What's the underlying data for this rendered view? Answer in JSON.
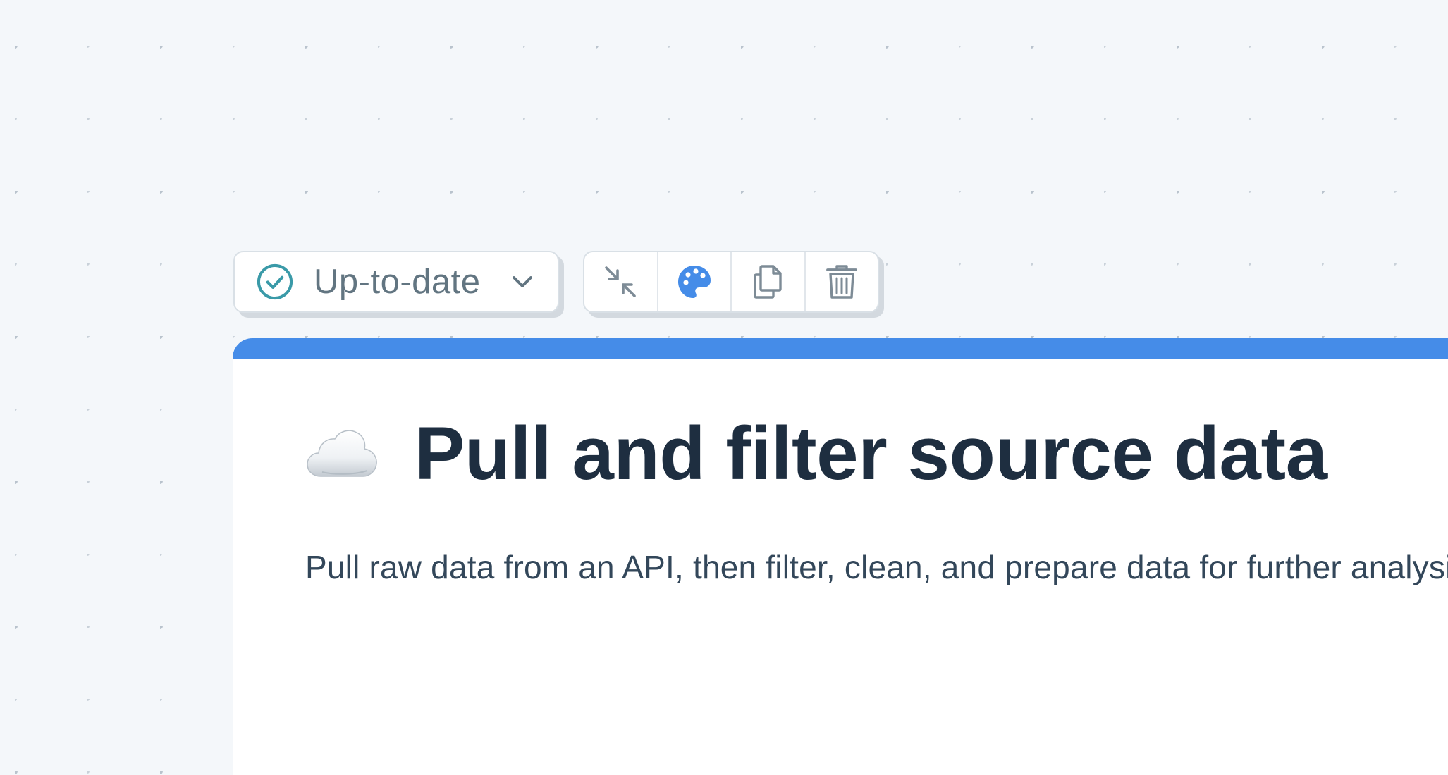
{
  "status": {
    "label": "Up-to-date",
    "icon": "check-circle-icon",
    "dropdown_icon": "chevron-down-icon"
  },
  "toolbar": {
    "buttons": [
      {
        "name": "collapse",
        "icon": "collapse-arrows-icon"
      },
      {
        "name": "color",
        "icon": "palette-icon"
      },
      {
        "name": "duplicate",
        "icon": "copy-icon"
      },
      {
        "name": "delete",
        "icon": "trash-icon"
      }
    ]
  },
  "card": {
    "emoji": "cloud-icon",
    "title": "Pull and filter source data",
    "description": "Pull raw data from an API, then filter, clean, and prepare data for further analysis"
  },
  "colors": {
    "accent": "#458ce8",
    "status_check": "#3a9aa8",
    "title_text": "#1e2e40",
    "muted_icon": "#7d8b96"
  }
}
